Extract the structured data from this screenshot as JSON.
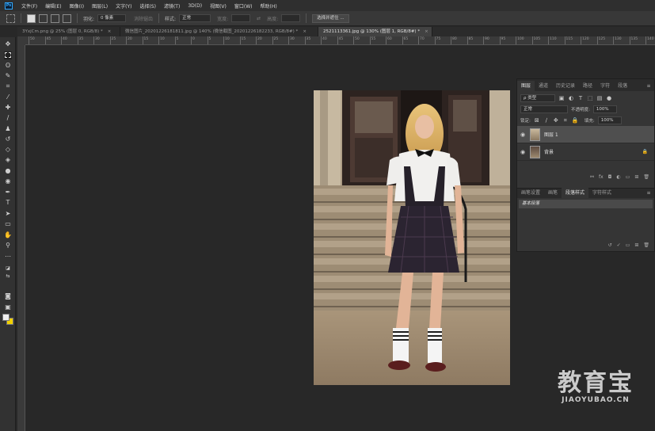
{
  "menubar": {
    "logo": "Ps",
    "items": [
      "文件(F)",
      "编辑(E)",
      "图像(I)",
      "图层(L)",
      "文字(Y)",
      "选择(S)",
      "滤镜(T)",
      "3D(D)",
      "视图(V)",
      "窗口(W)",
      "帮助(H)"
    ]
  },
  "options": {
    "feather_label": "羽化:",
    "feather_value": "0 像素",
    "antialias_label": "消除锯齿",
    "style_label": "样式:",
    "style_value": "正常",
    "width_label": "宽度:",
    "height_label": "高度:",
    "select_mask_button": "选择并遮住 ..."
  },
  "tabs": [
    {
      "label": "3YxjCm.png @ 25% (图层 0, RGB/8) *",
      "active": false
    },
    {
      "label": "微信图片_20201226181811.jpg @ 140% (微信截图_20201226182233, RGB/8#) *",
      "active": false
    },
    {
      "label": "2521113361.jpg @ 130% (图层 1, RGB/8#) *",
      "active": true
    }
  ],
  "ruler_numbers": [
    "50",
    "45",
    "40",
    "35",
    "30",
    "25",
    "20",
    "15",
    "10",
    "5",
    "0",
    "5",
    "10",
    "15",
    "20",
    "25",
    "30",
    "35",
    "40",
    "45",
    "50",
    "55",
    "60",
    "65",
    "70",
    "75",
    "80",
    "85",
    "90",
    "95",
    "100",
    "105",
    "110",
    "115",
    "120",
    "125",
    "130",
    "135",
    "140"
  ],
  "layers_panel": {
    "tabs": [
      "图层",
      "通道",
      "历史记录",
      "路径",
      "字符",
      "段落"
    ],
    "filter_kind": "ρ 类型",
    "blend_mode": "正常",
    "opacity_label": "不透明度:",
    "opacity_value": "100%",
    "lock_label": "锁定:",
    "fill_label": "填充:",
    "fill_value": "100%",
    "layers": [
      {
        "name": "图层 1",
        "selected": true
      },
      {
        "name": "背景",
        "selected": false,
        "locked": true
      }
    ]
  },
  "style_panel": {
    "tabs": [
      "画笔设置",
      "画笔",
      "段落样式",
      "字符样式"
    ],
    "active_tab": 2,
    "items": [
      "基本段落"
    ]
  },
  "watermark": {
    "big": "教育宝",
    "small": "JIAOYUBAO.CN"
  },
  "colors": {
    "foreground": "#efefef",
    "background": "#f2d100",
    "accent": "#31a8ff"
  }
}
